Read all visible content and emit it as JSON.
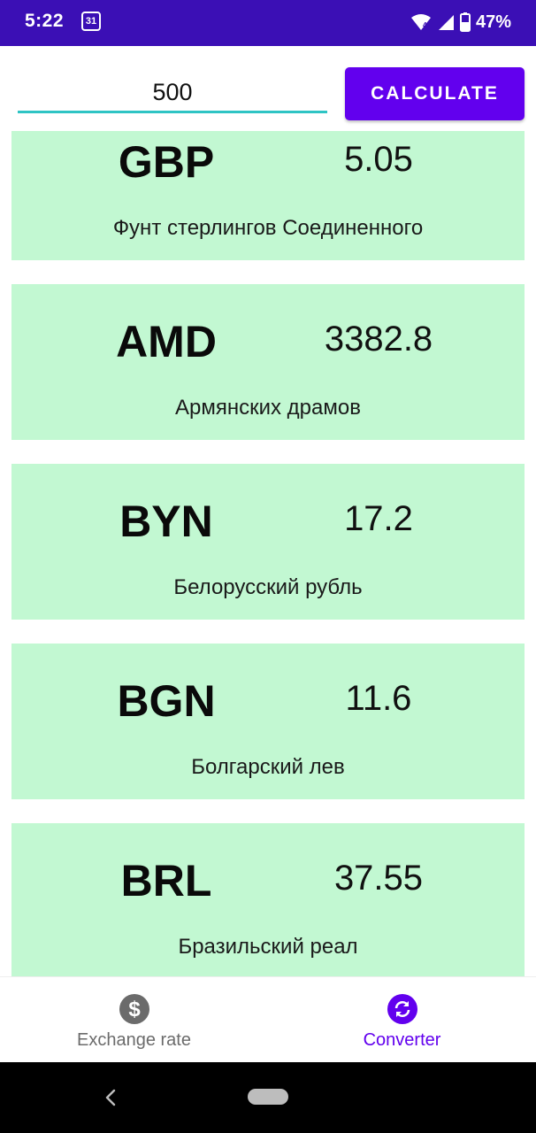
{
  "status_bar": {
    "time": "5:22",
    "calendar_day": "31",
    "battery_percent": "47%"
  },
  "converter": {
    "amount_value": "500",
    "calculate_label": "CALCULATE"
  },
  "currencies": [
    {
      "code": "GBP",
      "value": "5.05",
      "name": "Фунт стерлингов Соединенного"
    },
    {
      "code": "AMD",
      "value": "3382.8",
      "name": "Армянских драмов"
    },
    {
      "code": "BYN",
      "value": "17.2",
      "name": "Белорусский рубль"
    },
    {
      "code": "BGN",
      "value": "11.6",
      "name": "Болгарский лев"
    },
    {
      "code": "BRL",
      "value": "37.55",
      "name": "Бразильский реал"
    }
  ],
  "bottom_nav": {
    "items": [
      {
        "label": "Exchange rate",
        "icon": "dollar-icon",
        "selected": false
      },
      {
        "label": "Converter",
        "icon": "sync-icon",
        "selected": true
      }
    ]
  },
  "colors": {
    "status_bar": "#3b0fb5",
    "accent": "#6200ee",
    "card_background": "#c2f8d2",
    "input_underline": "#2ec4c4"
  }
}
